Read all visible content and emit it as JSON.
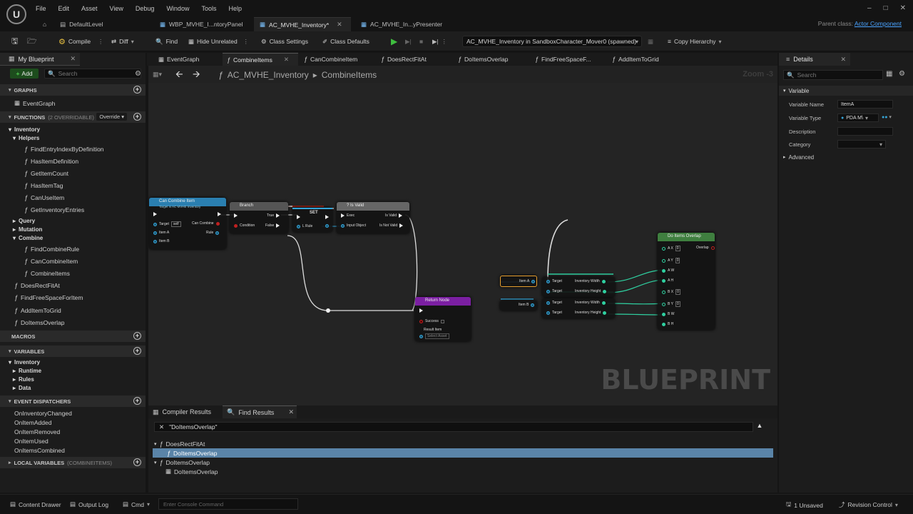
{
  "menu": [
    "File",
    "Edit",
    "Asset",
    "View",
    "Debug",
    "Window",
    "Tools",
    "Help"
  ],
  "doc_tabs": [
    {
      "label": "DefaultLevel",
      "active": false
    },
    {
      "label": "WBP_MVHE_I...ntoryPanel",
      "active": false
    },
    {
      "label": "AC_MVHE_Inventory*",
      "active": true
    },
    {
      "label": "AC_MVHE_In...yPresenter",
      "active": false
    }
  ],
  "parent_class": {
    "label": "Parent class:",
    "value": "Actor Component"
  },
  "toolbar": {
    "compile": "Compile",
    "diff": "Diff",
    "find": "Find",
    "hide_unrelated": "Hide Unrelated",
    "class_settings": "Class Settings",
    "class_defaults": "Class Defaults",
    "debug_object": "AC_MVHE_Inventory in SandboxCharacter_Mover0 (spawned)",
    "copy_hierarchy": "Copy Hierarchy"
  },
  "left_panel": {
    "title": "My Blueprint",
    "add": "Add",
    "search_placeholder": "Search",
    "graphs_header": "GRAPHS",
    "graphs": [
      "EventGraph"
    ],
    "functions_header": "FUNCTIONS",
    "functions_sub": "(2 OVERRIDABLE)",
    "override": "Override",
    "functions": {
      "inventory": "Inventory",
      "helpers": "Helpers",
      "helper_items": [
        "FindEntryIndexByDefinition",
        "HasItemDefinition",
        "GetItemCount",
        "HasItemTag",
        "CanUseItem",
        "GetInventoryEntries"
      ],
      "query": "Query",
      "mutation": "Mutation",
      "combine": "Combine",
      "combine_items": [
        "FindCombineRule",
        "CanCombineItem",
        "CombineItems"
      ],
      "root_items": [
        "DoesRectFitAt",
        "FindFreeSpaceForItem",
        "AddItemToGrid",
        "DoItemsOverlap"
      ]
    },
    "macros_header": "MACROS",
    "variables_header": "VARIABLES",
    "variables": {
      "inventory": "Inventory",
      "runtime": "Runtime",
      "rules": "Rules",
      "data": "Data"
    },
    "dispatchers_header": "EVENT DISPATCHERS",
    "dispatchers": [
      "OnInventoryChanged",
      "OnItemAdded",
      "OnItemRemoved",
      "OnItemUsed",
      "OnItemsCombined"
    ],
    "locals_header": "LOCAL VARIABLES",
    "locals_sub": "(COMBINEITEMS)"
  },
  "graph_tabs": [
    "EventGraph",
    "CombineItems",
    "CanCombineItem",
    "DoesRectFitAt",
    "DoItemsOverlap",
    "FindFreeSpaceF...",
    "AddItemToGrid"
  ],
  "graph": {
    "breadcrumb_class": "AC_MVHE_Inventory",
    "breadcrumb_fn": "CombineItems",
    "zoom": "Zoom -3",
    "watermark": "BLUEPRINT",
    "nodes": {
      "can_combine": {
        "title": "Can Combine Item",
        "sub": "Target is AC MVHE Inventory",
        "target": "Target",
        "self": "self",
        "out": "Can Combine",
        "item_a": "Item A",
        "item_b": "Item B"
      },
      "branch": {
        "title": "Branch",
        "condition": "Condition",
        "true": "True",
        "false": "False"
      },
      "set": {
        "title": "SET",
        "rule": "L Rule"
      },
      "is_valid": {
        "title": "Is Valid",
        "exec": "Exec",
        "input": "Input Object",
        "valid": "Is Valid",
        "not_valid": "Is Not Valid"
      },
      "return": {
        "title": "Return Node",
        "success": "Success",
        "result": "Result Item",
        "select": "Select Asset"
      },
      "do_overlap": {
        "title": "Do Items Overlap",
        "ax": "A X",
        "ay": "A Y",
        "aw": "A W",
        "ah": "A H",
        "bx": "B X",
        "by": "B Y",
        "bw": "B W",
        "bh": "B H",
        "out": "Overlap"
      },
      "getters": {
        "item_a": "Item A",
        "item_b": "Item B",
        "target": "Target",
        "inv_width": "Inventory Width",
        "inv_height": "Inventory Height"
      }
    }
  },
  "bottom": {
    "compiler_results": "Compiler Results",
    "find_results": "Find Results",
    "query": "\"DoItemsOverlap\"",
    "results": [
      {
        "label": "DoesRectFitAt",
        "level": 0,
        "selected": false
      },
      {
        "label": "DoItemsOverlap",
        "level": 1,
        "selected": true
      },
      {
        "label": "DoItemsOverlap",
        "level": 0,
        "selected": false
      },
      {
        "label": "DoItemsOverlap",
        "level": 1,
        "selected": false
      }
    ]
  },
  "details": {
    "title": "Details",
    "search_placeholder": "Search",
    "section": "Variable",
    "labels": {
      "name": "Variable Name",
      "type": "Variable Type",
      "description": "Description",
      "category": "Category"
    },
    "values": {
      "name": "ItemA",
      "type": "PDA M\\"
    },
    "advanced": "Advanced"
  },
  "status": {
    "content_drawer": "Content Drawer",
    "output_log": "Output Log",
    "cmd": "Cmd",
    "console_placeholder": "Enter Console Command",
    "unsaved": "1 Unsaved",
    "revision": "Revision Control"
  },
  "colors": {
    "accent": "#4aa3ff",
    "function_node": "#2a7fb0",
    "return_node": "#7b1fa2",
    "selected_row": "#5a84a8",
    "overlap_node": "#3f7f3f"
  }
}
